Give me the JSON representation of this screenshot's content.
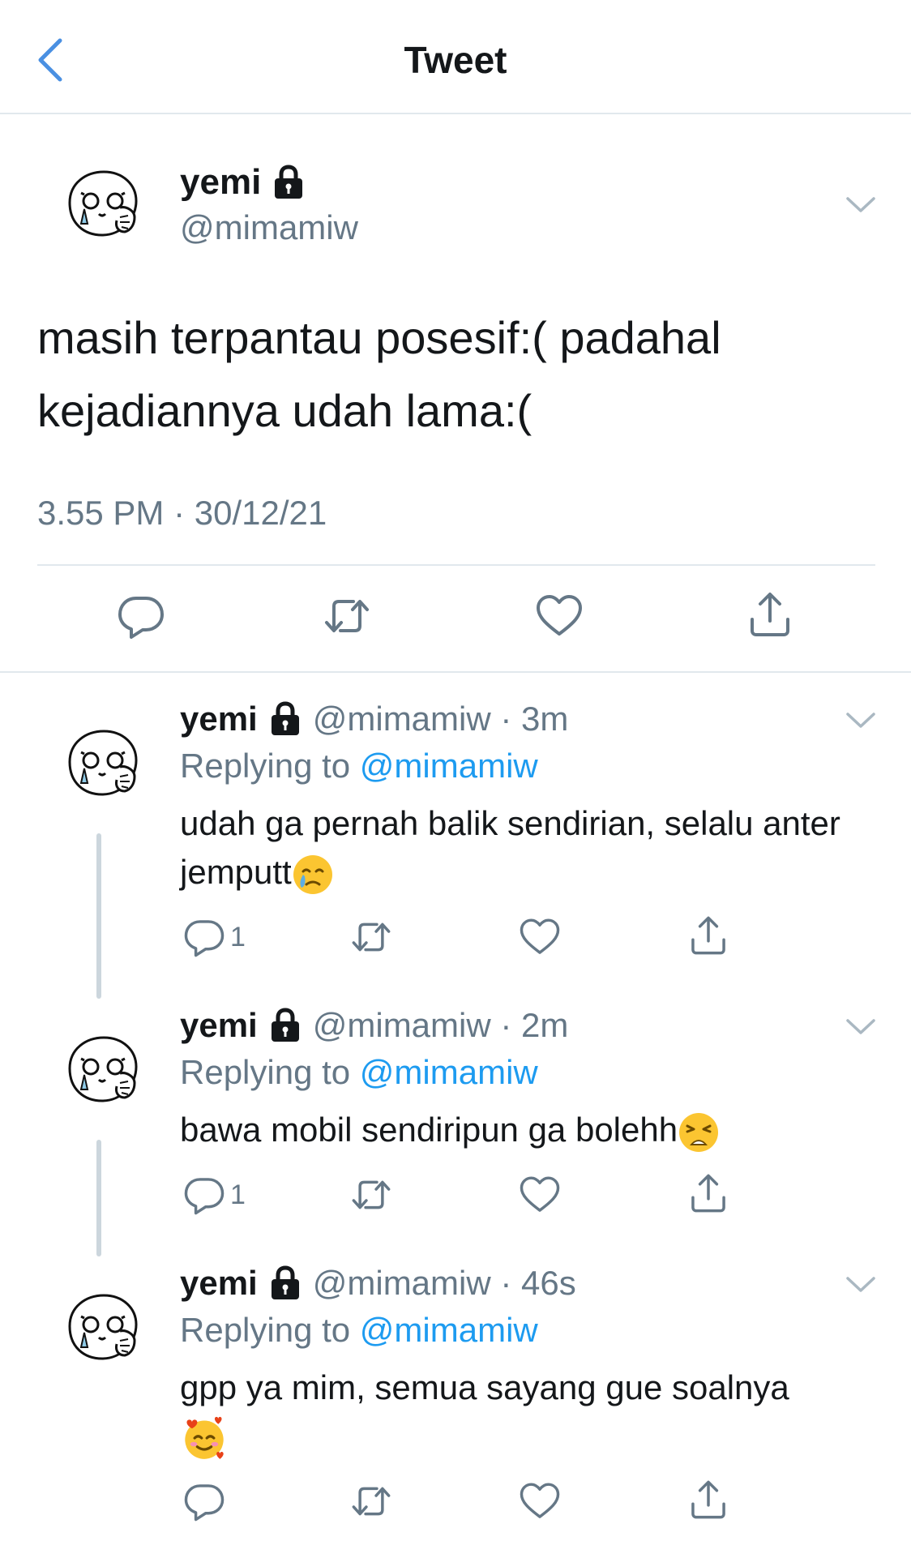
{
  "header": {
    "title": "Tweet"
  },
  "main_tweet": {
    "name": "yemi",
    "handle": "@mimamiw",
    "text": "masih terpantau posesif:( padahal kejadiannya udah lama:(",
    "timestamp": "3.55 PM · 30/12/21"
  },
  "replies": [
    {
      "name": "yemi",
      "handle_time": "@mimamiw · 3m",
      "replying_label": "Replying to",
      "mention": "@mimamiw",
      "text": "udah ga pernah balik sendirian, selalu anter jemputt",
      "emoji": "crying-face",
      "reply_count": "1"
    },
    {
      "name": "yemi",
      "handle_time": "@mimamiw · 2m",
      "replying_label": "Replying to",
      "mention": "@mimamiw",
      "text": "bawa mobil sendiripun ga bolehh",
      "emoji": "weary-face",
      "reply_count": "1"
    },
    {
      "name": "yemi",
      "handle_time": "@mimamiw · 46s",
      "replying_label": "Replying to",
      "mention": "@mimamiw",
      "text": "gpp ya mim, semua sayang gue soalnya",
      "emoji": "smiling-face-with-hearts",
      "reply_count": ""
    }
  ],
  "colors": {
    "accent": "#1d9bf0",
    "secondary_text": "#657786",
    "divider": "#e1e8ed"
  }
}
